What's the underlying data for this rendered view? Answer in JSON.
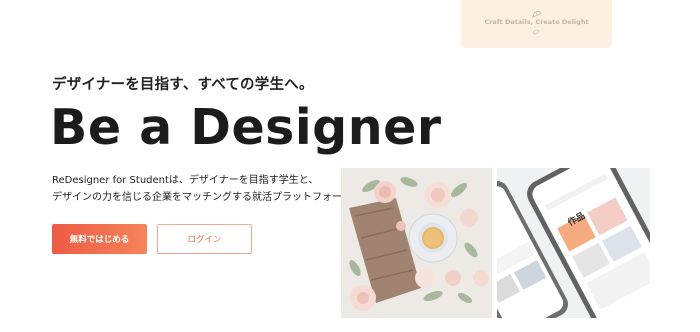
{
  "top_card": {
    "tagline": "Craft Details, Create Delight"
  },
  "hero": {
    "subtitle": "デザイナーを目指す、すべての学生へ。",
    "title": "Be a Designer",
    "description_line1": "ReDesigner for Studentは、デザイナーを目指す学生と、",
    "description_line2": "デザインの力を信じる企業をマッチングする就活プラットフォームです。"
  },
  "buttons": {
    "signup_label": "無料ではじめる",
    "login_label": "ログイン"
  },
  "phone_screen": {
    "section_title": "作品"
  },
  "colors": {
    "accent_start": "#ee5b45",
    "accent_end": "#f5845a",
    "card_bg": "#fdf0e2"
  }
}
